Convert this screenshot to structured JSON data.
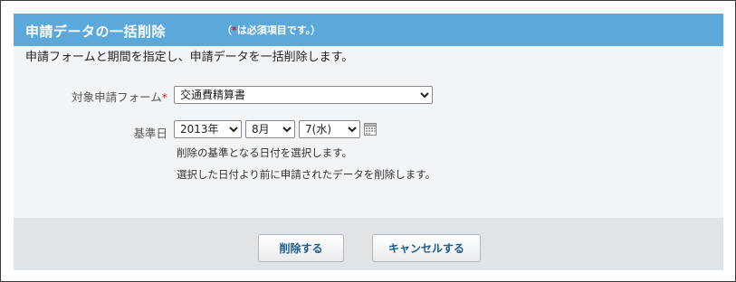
{
  "header": {
    "title": "申請データの一括削除",
    "note_open": "（",
    "note_mark": "*",
    "note_text": "は必須項目です。）"
  },
  "intro": "申請フォームと期間を指定し、申請データを一括削除します。",
  "form": {
    "target_label": "対象申請フォーム",
    "required_mark": "*",
    "target_value": "交通費精算書",
    "date_label": "基準日",
    "year_value": "2013年",
    "month_value": "8月",
    "day_value": "7(水)",
    "help_line1": "削除の基準となる日付を選択します。",
    "help_line2": "選択した日付より前に申請されたデータを削除します。"
  },
  "buttons": {
    "delete": "削除する",
    "cancel": "キャンセルする"
  },
  "icons": {
    "calendar": "calendar-icon"
  },
  "colors": {
    "header_bg": "#5ba9db",
    "required": "#cc1b1b",
    "button_text": "#1d5c8f"
  }
}
